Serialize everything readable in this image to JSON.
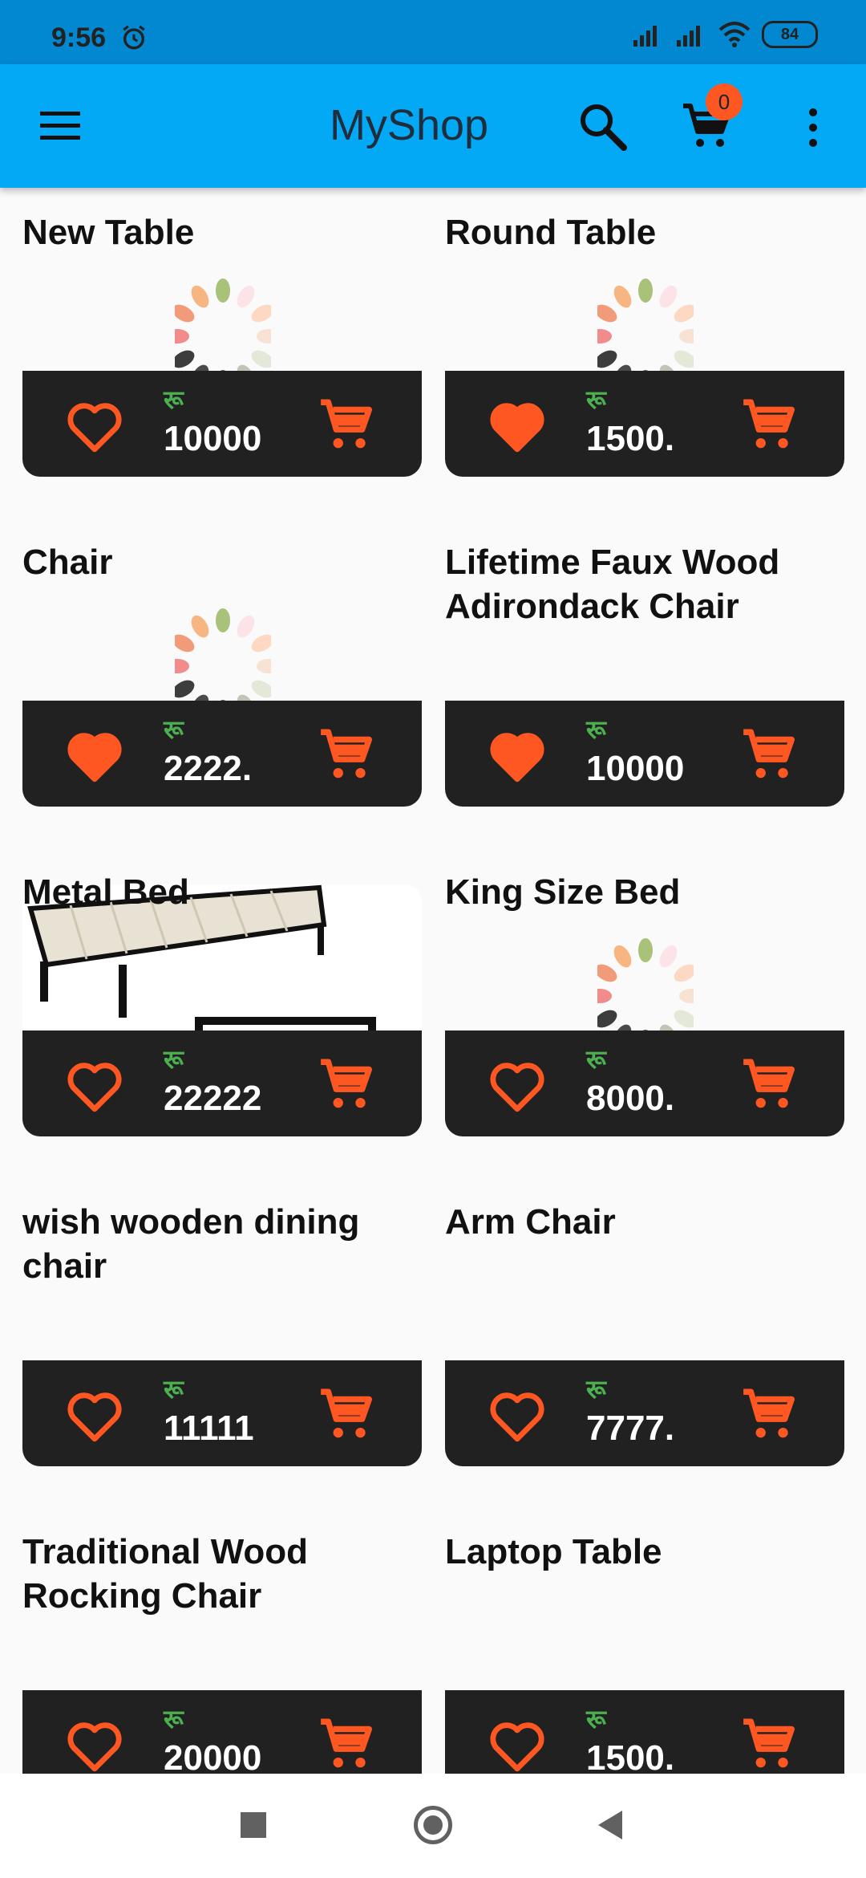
{
  "status": {
    "time": "9:56",
    "battery": "84"
  },
  "appbar": {
    "title": "MyShop",
    "cart_count": "0"
  },
  "currency": "रू",
  "products": [
    {
      "name": "New Table",
      "price": "10000",
      "favorite": false,
      "loading": true
    },
    {
      "name": "Round  Table",
      "price": "1500.",
      "favorite": true,
      "loading": true
    },
    {
      "name": "Chair",
      "price": "2222.",
      "favorite": true,
      "loading": true
    },
    {
      "name": "Lifetime Faux Wood Adirondack Chair",
      "price": "10000",
      "favorite": true,
      "loading": false
    },
    {
      "name": "Metal Bed",
      "price": "22222",
      "favorite": false,
      "loading": false
    },
    {
      "name": "King Size Bed",
      "price": "8000.",
      "favorite": false,
      "loading": true
    },
    {
      "name": "wish wooden dining chair",
      "price": "11111",
      "favorite": false,
      "loading": false
    },
    {
      "name": "Arm Chair",
      "price": "7777.",
      "favorite": false,
      "loading": false
    },
    {
      "name": " Traditional Wood Rocking Chair",
      "price": "20000",
      "favorite": false,
      "loading": false
    },
    {
      "name": "Laptop Table",
      "price": "1500.",
      "favorite": false,
      "loading": false
    }
  ],
  "colors": {
    "accent": "#ff5722",
    "appbar": "#03a9f4",
    "statusbar": "#0288d1",
    "card": "#212121",
    "currency": "#4caf50"
  }
}
